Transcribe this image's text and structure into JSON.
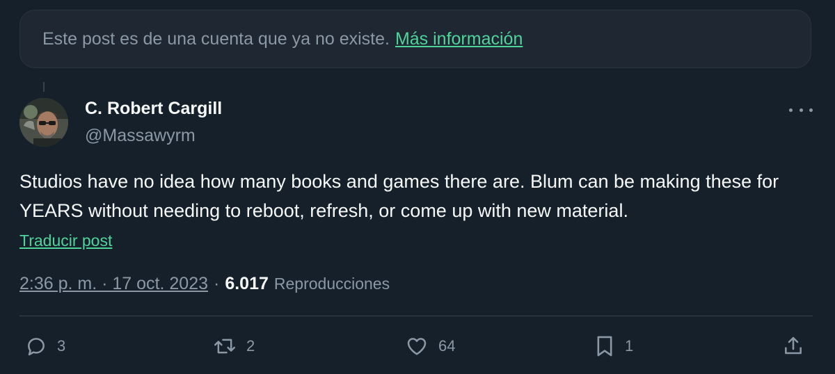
{
  "notice": {
    "text": "Este post es de una cuenta que ya no existe.",
    "link": "Más información"
  },
  "author": {
    "name": "C. Robert Cargill",
    "handle": "@Massawyrm"
  },
  "post": {
    "text": "Studios have no idea how many books and games there are. Blum can be making these for YEARS without needing to reboot, refresh, or come up with new material.",
    "translate_label": "Traducir post"
  },
  "meta": {
    "timestamp": "2:36 p. m. · 17 oct. 2023",
    "separator": "·",
    "views": "6.017",
    "views_label": "Reproducciones"
  },
  "actions": {
    "replies": "3",
    "reposts": "2",
    "likes": "64",
    "bookmarks": "1"
  },
  "icons": {
    "reply": "reply-icon",
    "repost": "repost-icon",
    "like": "heart-icon",
    "bookmark": "bookmark-icon",
    "share": "share-icon",
    "more": "more-icon"
  },
  "colors": {
    "background": "#15202b",
    "accent": "#4fd49a",
    "muted": "#8b98a5",
    "text": "#f7f9f9"
  }
}
